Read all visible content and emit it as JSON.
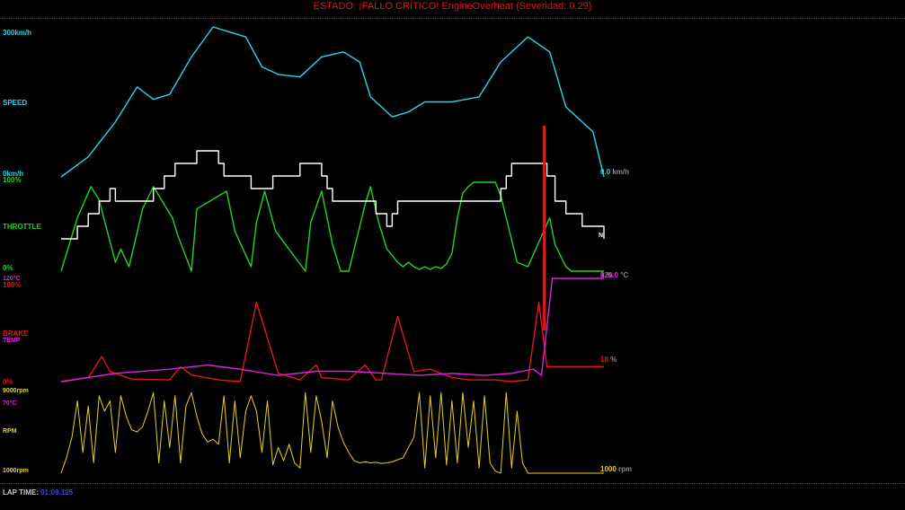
{
  "status": {
    "prefix": "ESTADO: ",
    "text": "¡FALLO CRÍTICO! EngineOverheat (Severidad: 0.29)",
    "full": "ESTADO: ¡FALLO CRÍTICO! EngineOverheat (Severidad: 0.29)"
  },
  "colors": {
    "speed": "#2fd3e8",
    "throttle": "#22d422",
    "brake": "#e01818",
    "temp": "#e020e0",
    "rpm": "#e6d21a",
    "gear": "#ffffff",
    "marker": "#e01818",
    "laptime": "#3a4bd9"
  },
  "speed": {
    "label": "SPEED",
    "max_label": "300km/h",
    "min_label": "0km/h",
    "current_value": "0.0",
    "current_unit": "km/h"
  },
  "throttle": {
    "label": "THROTTLE",
    "max_label": "100%",
    "min_label": "0%",
    "current_value": "0 %"
  },
  "brake": {
    "label": "BRAKE",
    "max_label": "100%",
    "min_label": "0%",
    "current_value": "18",
    "current_unit": "%"
  },
  "temp": {
    "label": "TEMP",
    "max_label": "120°C",
    "min_label": "70°C",
    "current_value": "120.0",
    "current_unit": "°C"
  },
  "rpm": {
    "label": "RPM",
    "max_label": "9000rpm",
    "min_label": "1000rpm",
    "current_value": "1000",
    "current_unit": "rpm"
  },
  "gear": {
    "current_label": "N"
  },
  "lap": {
    "label": "LAP TIME:",
    "value": "01:09.125"
  },
  "chart_data": {
    "type": "line",
    "x_label": "",
    "series": [
      {
        "name": "SPEED",
        "unit": "km/h",
        "range": [
          0,
          300
        ],
        "x": [
          0,
          5,
          10,
          14,
          17,
          20,
          24,
          28,
          31,
          34,
          37,
          40,
          44,
          48,
          52,
          55,
          57,
          61,
          64,
          67,
          72,
          77,
          81,
          86,
          90,
          93,
          98,
          100
        ],
        "values": [
          0,
          40,
          110,
          180,
          155,
          165,
          240,
          300,
          290,
          280,
          220,
          205,
          200,
          240,
          250,
          230,
          160,
          120,
          130,
          150,
          150,
          160,
          230,
          280,
          250,
          140,
          90,
          0
        ]
      },
      {
        "name": "THROTTLE",
        "unit": "%",
        "range": [
          0,
          100
        ],
        "x": [
          0,
          3,
          5.5,
          7,
          10,
          11,
          12.5,
          13.5,
          15,
          17,
          20.5,
          21.5,
          24,
          25,
          30.5,
          32,
          35,
          36,
          37.5,
          39.5,
          45,
          46,
          48,
          50,
          51.5,
          53,
          56,
          57,
          58.5,
          60,
          62,
          63,
          64,
          65,
          66,
          67,
          68,
          69,
          70,
          71,
          72,
          73,
          74,
          75,
          76,
          80,
          81,
          84,
          86,
          90,
          91,
          93,
          94,
          95.5,
          100
        ],
        "values": [
          0,
          60,
          95,
          80,
          10,
          25,
          5,
          30,
          70,
          95,
          60,
          40,
          0,
          70,
          90,
          45,
          5,
          55,
          90,
          45,
          0,
          55,
          90,
          30,
          0,
          0,
          75,
          95,
          55,
          25,
          10,
          5,
          10,
          5,
          2,
          5,
          2,
          5,
          3,
          8,
          20,
          60,
          88,
          95,
          100,
          100,
          85,
          10,
          5,
          60,
          30,
          5,
          0,
          0,
          0
        ]
      },
      {
        "name": "BRAKE",
        "unit": "%",
        "range": [
          0,
          100
        ],
        "x": [
          0,
          5,
          7.5,
          9,
          13,
          20,
          22,
          24,
          29,
          33,
          36,
          40,
          44,
          47,
          48,
          53,
          56,
          58,
          59,
          62,
          65,
          68,
          72,
          75,
          80,
          83,
          86,
          88,
          89.5,
          100
        ],
        "values": [
          0,
          5,
          30,
          12,
          3,
          2,
          18,
          8,
          2,
          0,
          95,
          10,
          2,
          20,
          5,
          2,
          20,
          2,
          2,
          78,
          12,
          15,
          5,
          2,
          2,
          0,
          2,
          95,
          18,
          18
        ]
      },
      {
        "name": "TEMP",
        "unit": "°C",
        "range": [
          70,
          120
        ],
        "x": [
          0,
          10,
          20,
          27,
          33,
          40,
          47,
          53,
          60,
          66,
          72,
          78,
          83,
          87,
          88.5,
          90.5,
          100
        ],
        "values": [
          70,
          74,
          76,
          78,
          76,
          73,
          75,
          75,
          74,
          73,
          74,
          73,
          74,
          76,
          73,
          120,
          120
        ]
      },
      {
        "name": "RPM",
        "unit": "rpm",
        "range": [
          1000,
          9000
        ],
        "x": [
          0,
          1,
          2,
          3,
          4,
          5,
          6,
          7,
          8,
          9,
          10,
          11,
          12,
          13,
          14,
          15,
          16,
          17,
          18,
          19,
          20,
          21,
          22,
          23,
          24,
          25,
          26,
          27,
          28,
          29,
          30,
          31,
          32,
          33,
          34,
          35,
          36,
          37,
          38,
          39,
          40,
          41,
          42,
          43,
          44,
          45,
          46,
          47,
          48,
          49,
          50,
          51,
          52,
          53,
          54,
          55,
          56,
          57,
          58,
          59,
          60,
          61,
          62,
          63,
          64,
          65,
          66,
          67,
          68,
          69,
          70,
          71,
          72,
          73,
          74,
          75,
          76,
          77,
          78,
          79,
          80,
          81,
          82,
          83,
          84,
          85,
          86,
          87,
          88,
          89,
          90,
          91,
          92,
          93,
          94,
          95,
          96,
          97,
          98,
          99,
          100
        ],
        "values": [
          1000,
          2500,
          4500,
          8000,
          3000,
          7500,
          2000,
          8500,
          7000,
          8000,
          3000,
          8500,
          6500,
          5200,
          5000,
          5500,
          7000,
          8800,
          2000,
          8000,
          3500,
          8500,
          2000,
          7500,
          8800,
          6500,
          4800,
          4000,
          4300,
          3800,
          8500,
          2000,
          8000,
          2500,
          7000,
          8500,
          7000,
          3000,
          8000,
          1800,
          3500,
          2200,
          3800,
          2000,
          1500,
          8800,
          3000,
          8500,
          6000,
          2500,
          8000,
          5500,
          4000,
          3000,
          2200,
          2000,
          2100,
          2000,
          2050,
          1950,
          2000,
          2100,
          2300,
          2500,
          3500,
          4500,
          8800,
          1500,
          8500,
          2500,
          8800,
          1800,
          8000,
          2000,
          8800,
          3500,
          8000,
          1500,
          8500,
          2000,
          1200,
          1000,
          8800,
          1500,
          7000,
          2000,
          1000,
          1000,
          1000,
          1000,
          1000,
          1000,
          1000,
          1000,
          1000,
          1000,
          1000,
          1000,
          1000,
          1000,
          1000
        ]
      },
      {
        "name": "GEAR",
        "unit": "",
        "x": [
          0,
          3,
          5,
          7,
          8.5,
          9,
          10,
          13,
          17,
          19,
          21,
          22,
          25,
          27,
          29,
          30,
          35,
          37,
          39,
          40,
          44,
          45,
          48,
          49,
          50,
          51,
          58,
          60,
          61,
          62,
          64,
          65,
          66,
          67,
          71,
          72,
          73,
          73.5,
          74,
          75,
          76,
          80,
          81,
          82,
          83,
          84,
          85,
          86,
          87,
          88,
          89.5,
          91,
          93,
          96,
          100
        ],
        "values": [
          0,
          1,
          2,
          3,
          3,
          4,
          3,
          3,
          4,
          5,
          6,
          6,
          7,
          7,
          6,
          5,
          4,
          4,
          5,
          5,
          6,
          6,
          5,
          4,
          3,
          3,
          2,
          1,
          2,
          3,
          3,
          3,
          3,
          3,
          3,
          3,
          3,
          3,
          3,
          3,
          3,
          3,
          4,
          5,
          6,
          6,
          6,
          6,
          6,
          6,
          5,
          3,
          2,
          1,
          0
        ]
      }
    ],
    "markers": [
      {
        "x": 89
      }
    ]
  }
}
